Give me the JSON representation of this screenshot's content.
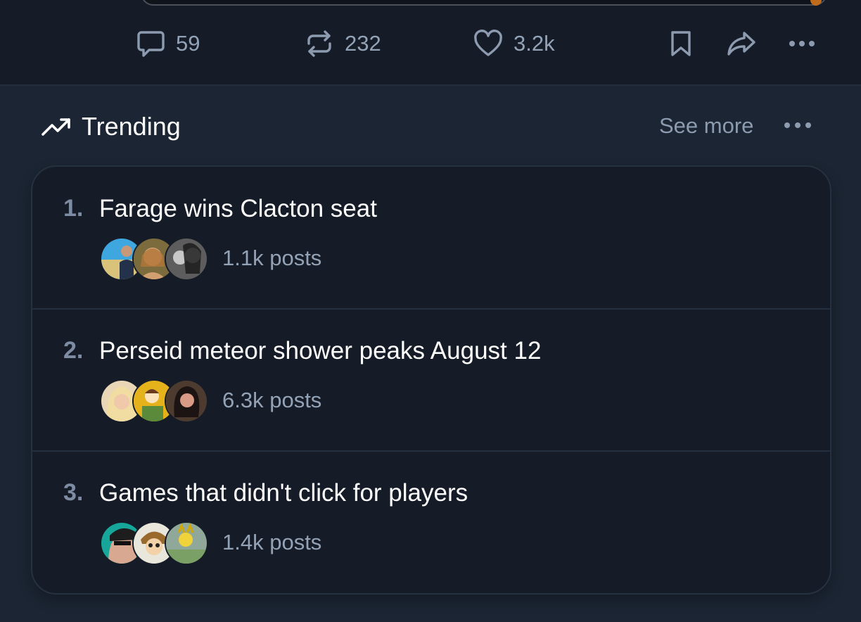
{
  "post_actions": {
    "replies": {
      "icon": "reply-icon",
      "count": "59"
    },
    "reposts": {
      "icon": "repost-icon",
      "count": "232"
    },
    "likes": {
      "icon": "heart-icon",
      "count": "3.2k"
    },
    "bookmark": {
      "icon": "bookmark-icon"
    },
    "share": {
      "icon": "share-icon"
    },
    "more": {
      "icon": "more-icon"
    }
  },
  "trending": {
    "icon": "trending-up-icon",
    "title": "Trending",
    "see_more_label": "See more",
    "more_icon": "more-icon",
    "topics": [
      {
        "rank": "1.",
        "title": "Farage wins Clacton seat",
        "posts": "1.1k posts"
      },
      {
        "rank": "2.",
        "title": "Perseid meteor shower peaks August 12",
        "posts": "6.3k posts"
      },
      {
        "rank": "3.",
        "title": "Games that didn't click for players",
        "posts": "1.4k posts"
      }
    ]
  },
  "colors": {
    "page_background": "#1b2533",
    "card_background": "#151c27",
    "muted_text": "#8d9bb0",
    "rank_text": "#7e8ca3"
  }
}
